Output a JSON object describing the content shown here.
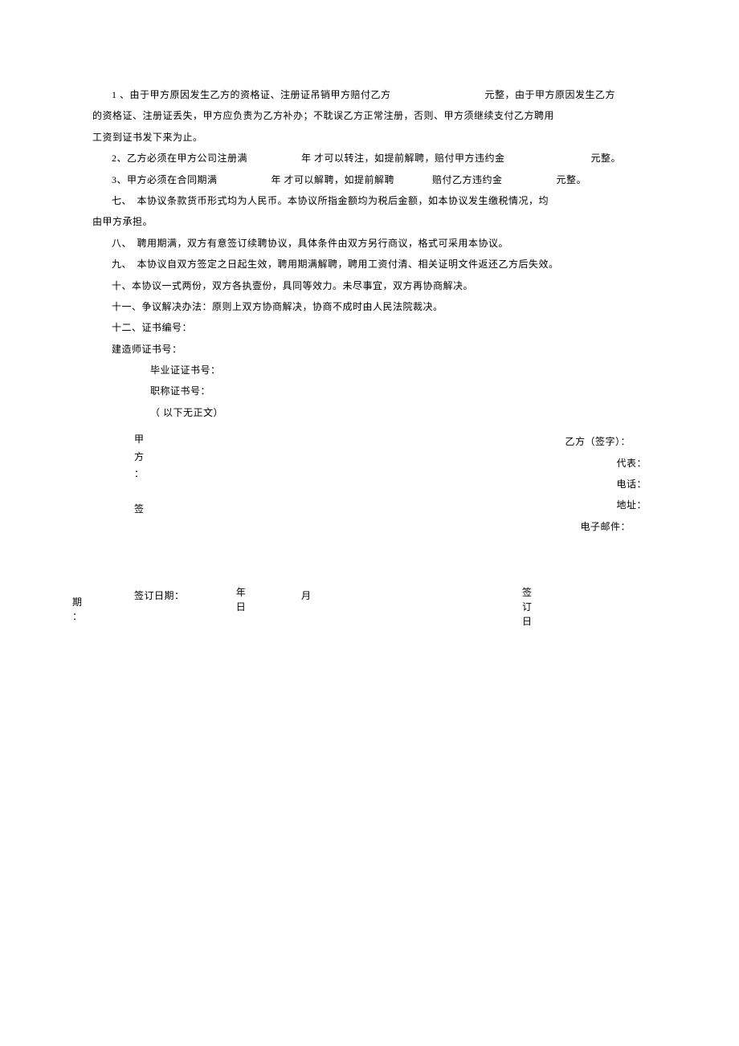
{
  "p1a": "1 、由于甲方原因发生乙方的资格证、注册证吊销甲方赔付乙方",
  "p1b": "元整，由于甲方原因发生乙方",
  "p1c": "的资格证、注册证丢失，甲方应负责为乙方补办；不耽误乙方正常注册，否则、甲方须继续支付乙方聘用",
  "p1d": "工资到证书发下来为止。",
  "p2a": "2、乙方必须在甲方公司注册满",
  "p2b": "年 才可以转注，如提前解聘，赔付甲方违约金",
  "p2c": "元整。",
  "p3a": "3、甲方必须在合同期满",
  "p3b": "年 才可以解聘，如提前解聘",
  "p3c": "赔付乙方违约金",
  "p3d": "元整。",
  "p7a": "七、　本协议条款货币形式均为人民币。本协议所指金额均为税后金额，如本协议发生缴税情况，均",
  "p7b": "由甲方承担。",
  "p8": "八、　聘用期满，双方有意签订续聘协议，具体条件由双方另行商议，格式可采用本协议。",
  "p9": "九、　本协议自双方签定之日起生效，聘用期满解聘，聘用工资付清、相关证明文件返还乙方后失效。",
  "p10": "十、本协议一式两份，双方各执壹份，具同等效力。未尽事宜，双方再协商解决。",
  "p11": "十一、争议解决办法：原则上双方协商解决，协商不成时由人民法院裁决。",
  "p12": "十二、证书编号：",
  "cert1": "建造师证书号：",
  "cert2": "毕业证证书号：",
  "cert3": "职称证书号：",
  "endnote": "（ 以下无正文）",
  "sigL1": "甲",
  "sigL2": "方",
  "sigL3": "：",
  "sigL4": "签",
  "sigR1": "乙方（签字）：",
  "sigR2": "代表：",
  "sigR3": "电话：",
  "sigR4": "地址：",
  "sigR5": "电子邮件：",
  "dateLabel": "签订日期：",
  "dateYear": "年",
  "dateDay": "日",
  "dateMonth": "月",
  "dr1": "签",
  "dr2": "订",
  "dr3": "日",
  "hang1": "期",
  "hang2": "："
}
